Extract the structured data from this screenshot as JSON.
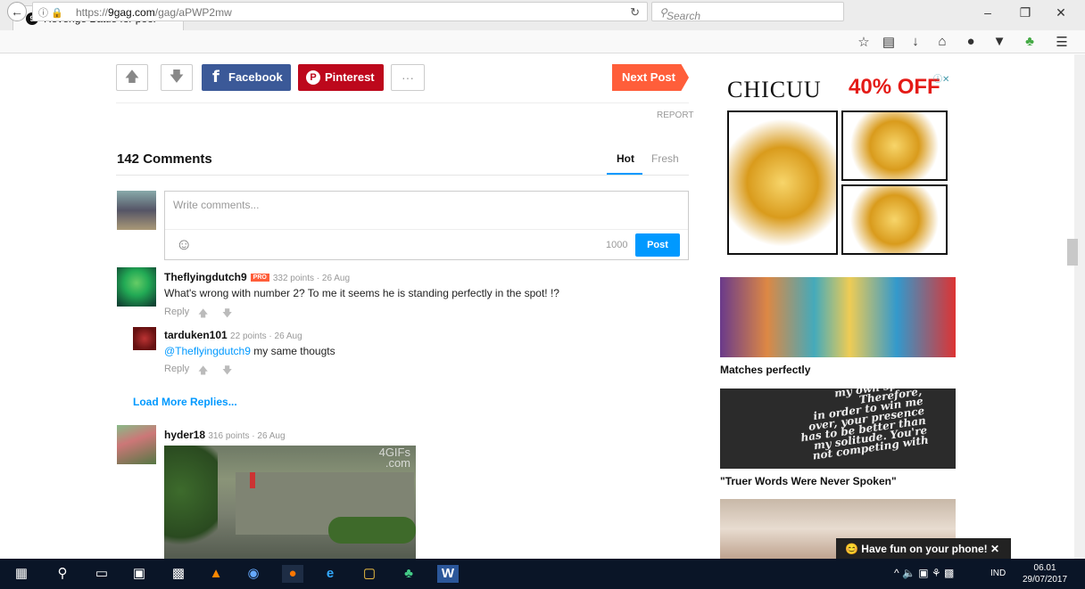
{
  "browser": {
    "tab_title": "Revenge Battle for poor p...",
    "tab_close": "✕",
    "new_tab": "+",
    "url_prefix": "https://",
    "url_domain": "9gag.com",
    "url_path": "/gag/aPWP2mw",
    "search_placeholder": "Search",
    "window_minimize": "–",
    "window_restore": "❐",
    "window_close": "✕"
  },
  "post_actions": {
    "facebook_label": "Facebook",
    "pinterest_label": "Pinterest",
    "more_label": "···",
    "next_label": "Next Post",
    "report_label": "REPORT"
  },
  "comments": {
    "count_label": "142 Comments",
    "tab_hot": "Hot",
    "tab_fresh": "Fresh",
    "input_placeholder": "Write comments...",
    "char_limit": "1000",
    "post_label": "Post",
    "load_more": "Load More Replies...",
    "items": [
      {
        "user": "Theflyingdutch9",
        "badge": "PRO",
        "meta": "332 points · 26 Aug",
        "text": "What's wrong with number 2? To me it seems he is standing perfectly in the spot! !?",
        "reply": "Reply"
      },
      {
        "user": "tarduken101",
        "meta": "22 points · 26 Aug",
        "mention": "@Theflyingdutch9",
        "text": " my same thougts",
        "reply": "Reply"
      },
      {
        "user": "hyder18",
        "meta": "316 points · 26 Aug",
        "gif_watermark_1": "4GIFs",
        "gif_watermark_2": ".com"
      }
    ]
  },
  "ads": {
    "brand": "CHICUU",
    "discount": "40% OFF",
    "caption_1": "Matches perfectly",
    "quote_lines": [
      "my own space.",
      "Therefore,",
      "in order to win me",
      "over, your presence",
      "has to be better than",
      "my solitude. You're",
      "not competing with"
    ],
    "caption_2": "\"Truer Words Were Never Spoken\"",
    "phone_banner": "😊 Have fun on your phone! ✕"
  },
  "taskbar": {
    "language": "IND",
    "time": "06.01",
    "date": "29/07/2017"
  },
  "colors": {
    "facebook": "#3b5998",
    "pinterest": "#bd081c",
    "next_post": "#ff5e3a",
    "accent_blue": "#0099ff",
    "taskbar": "#0a1527"
  }
}
